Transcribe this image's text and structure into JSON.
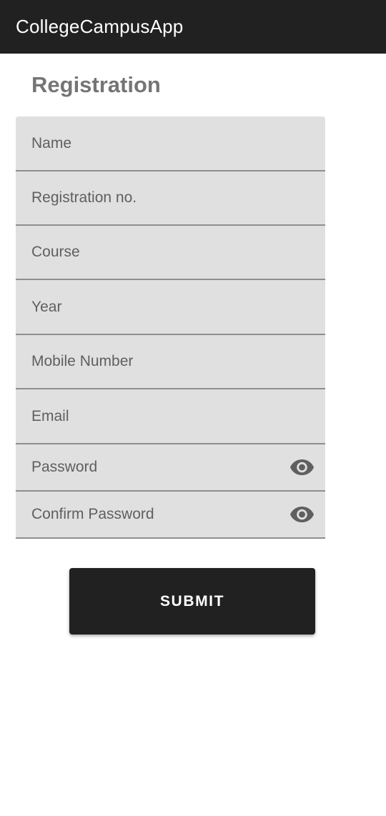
{
  "app_bar": {
    "title": "CollegeCampusApp"
  },
  "page": {
    "title": "Registration"
  },
  "form": {
    "fields": [
      {
        "label": "Name"
      },
      {
        "label": "Registration no."
      },
      {
        "label": "Course"
      },
      {
        "label": "Year"
      },
      {
        "label": "Mobile Number"
      },
      {
        "label": "Email"
      },
      {
        "label": "Password",
        "icon": "eye-icon"
      },
      {
        "label": "Confirm Password",
        "icon": "eye-icon"
      }
    ],
    "submit_label": "SUBMIT"
  },
  "colors": {
    "app_bar": "#212121",
    "field_background": "#e0e0e0",
    "button": "#212121",
    "title_text": "#757575"
  }
}
